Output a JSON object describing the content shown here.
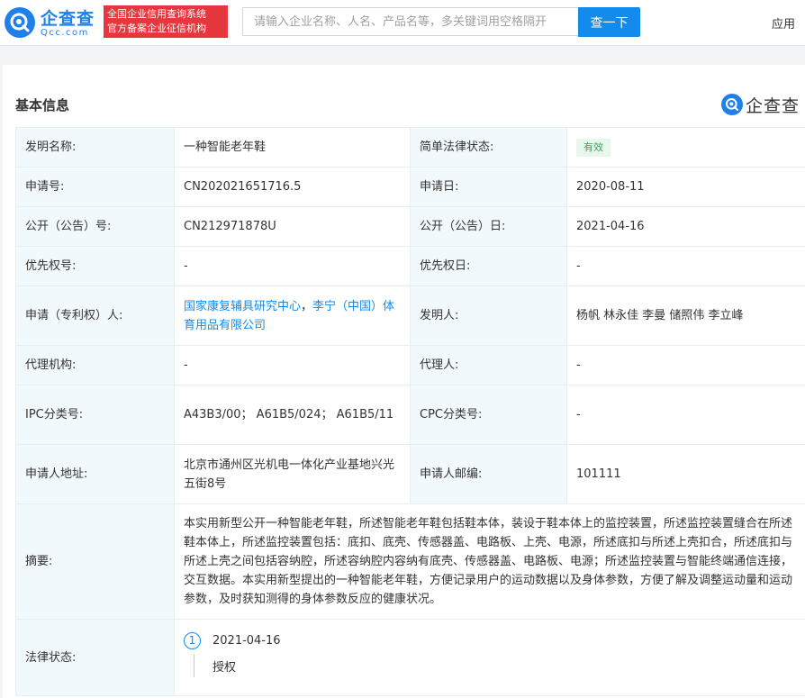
{
  "header": {
    "logo_name": "企查查",
    "logo_domain": "Qcc.com",
    "slogan_line1": "全国企业信用查询系统",
    "slogan_line2": "官方备案企业征信机构",
    "search_placeholder": "请输入企业名称、人名、产品名等，多关键词用空格隔开",
    "search_button": "查一下",
    "app_link": "应用"
  },
  "section": {
    "title": "基本信息",
    "watermark": "企查查"
  },
  "info": {
    "r1": {
      "l1": "发明名称:",
      "v1": "一种智能老年鞋",
      "l2": "简单法律状态:",
      "v2": "有效"
    },
    "r2": {
      "l1": "申请号:",
      "v1": "CN202021651716.5",
      "l2": "申请日:",
      "v2": "2020-08-11"
    },
    "r3": {
      "l1": "公开（公告）号:",
      "v1": "CN212971878U",
      "l2": "公开（公告）日:",
      "v2": "2021-04-16"
    },
    "r4": {
      "l1": "优先权号:",
      "v1": "-",
      "l2": "优先权日:",
      "v2": "-"
    },
    "r5": {
      "l1": "申请（专利权）人:",
      "v1a": "国家康复辅具研究中心",
      "sep": "，",
      "v1b": "李宁（中国）体育用品有限公司",
      "l2": "发明人:",
      "v2": "杨帆 林永佳 李曼 储照伟 李立峰"
    },
    "r6": {
      "l1": "代理机构:",
      "v1": "-",
      "l2": "代理人:",
      "v2": "-"
    },
    "r7": {
      "l1": "IPC分类号:",
      "v1": "A43B3/00； A61B5/024； A61B5/11",
      "l2": "CPC分类号:",
      "v2": "-"
    },
    "r8": {
      "l1": "申请人地址:",
      "v1": "北京市通州区光机电一体化产业基地兴光五街8号",
      "l2": "申请人邮编:",
      "v2": "101111"
    },
    "r9": {
      "l1": "摘要:",
      "v1": "本实用新型公开一种智能老年鞋，所述智能老年鞋包括鞋本体，装设于鞋本体上的监控装置，所述监控装置缝合在所述鞋本体上，所述监控装置包括：底扣、底壳、传感器盖、电路板、上壳、电源，所述底扣与所述上壳扣合，所述底扣与所述上壳之间包括容纳腔，所述容纳腔内容纳有底壳、传感器盖、电路板、电源；所述监控装置与智能终端通信连接，交互数据。本实用新型提出的一种智能老年鞋，方便记录用户的运动数据以及身体参数，方便了解及调整运动量和运动参数，及时获知测得的身体参数反应的健康状况。"
    },
    "r10": {
      "l1": "法律状态:",
      "step_num": "1",
      "step_date": "2021-04-16",
      "step_desc": "授权"
    }
  },
  "colors": {
    "brand": "#1f80ea",
    "search_button": "#128bed",
    "slogan_bg": "#e6373e",
    "label_bg": "#f2f9fc",
    "status_green": "#32a35f"
  }
}
